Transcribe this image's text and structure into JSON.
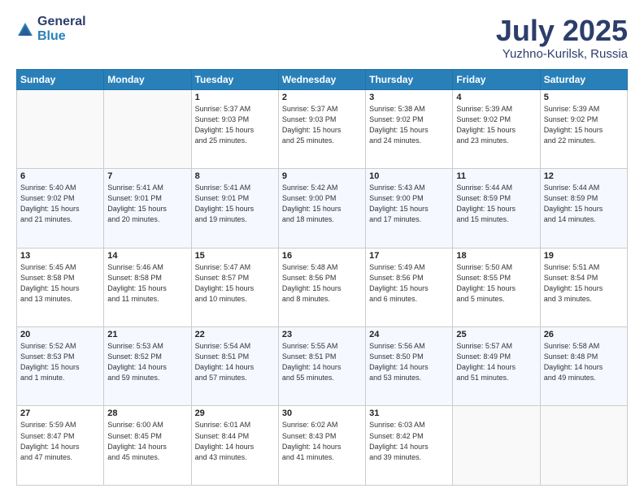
{
  "logo": {
    "general": "General",
    "blue": "Blue"
  },
  "title": {
    "month": "July 2025",
    "location": "Yuzhno-Kurilsk, Russia"
  },
  "weekdays": [
    "Sunday",
    "Monday",
    "Tuesday",
    "Wednesday",
    "Thursday",
    "Friday",
    "Saturday"
  ],
  "weeks": [
    [
      {
        "day": "",
        "info": ""
      },
      {
        "day": "",
        "info": ""
      },
      {
        "day": "1",
        "info": "Sunrise: 5:37 AM\nSunset: 9:03 PM\nDaylight: 15 hours\nand 25 minutes."
      },
      {
        "day": "2",
        "info": "Sunrise: 5:37 AM\nSunset: 9:03 PM\nDaylight: 15 hours\nand 25 minutes."
      },
      {
        "day": "3",
        "info": "Sunrise: 5:38 AM\nSunset: 9:02 PM\nDaylight: 15 hours\nand 24 minutes."
      },
      {
        "day": "4",
        "info": "Sunrise: 5:39 AM\nSunset: 9:02 PM\nDaylight: 15 hours\nand 23 minutes."
      },
      {
        "day": "5",
        "info": "Sunrise: 5:39 AM\nSunset: 9:02 PM\nDaylight: 15 hours\nand 22 minutes."
      }
    ],
    [
      {
        "day": "6",
        "info": "Sunrise: 5:40 AM\nSunset: 9:02 PM\nDaylight: 15 hours\nand 21 minutes."
      },
      {
        "day": "7",
        "info": "Sunrise: 5:41 AM\nSunset: 9:01 PM\nDaylight: 15 hours\nand 20 minutes."
      },
      {
        "day": "8",
        "info": "Sunrise: 5:41 AM\nSunset: 9:01 PM\nDaylight: 15 hours\nand 19 minutes."
      },
      {
        "day": "9",
        "info": "Sunrise: 5:42 AM\nSunset: 9:00 PM\nDaylight: 15 hours\nand 18 minutes."
      },
      {
        "day": "10",
        "info": "Sunrise: 5:43 AM\nSunset: 9:00 PM\nDaylight: 15 hours\nand 17 minutes."
      },
      {
        "day": "11",
        "info": "Sunrise: 5:44 AM\nSunset: 8:59 PM\nDaylight: 15 hours\nand 15 minutes."
      },
      {
        "day": "12",
        "info": "Sunrise: 5:44 AM\nSunset: 8:59 PM\nDaylight: 15 hours\nand 14 minutes."
      }
    ],
    [
      {
        "day": "13",
        "info": "Sunrise: 5:45 AM\nSunset: 8:58 PM\nDaylight: 15 hours\nand 13 minutes."
      },
      {
        "day": "14",
        "info": "Sunrise: 5:46 AM\nSunset: 8:58 PM\nDaylight: 15 hours\nand 11 minutes."
      },
      {
        "day": "15",
        "info": "Sunrise: 5:47 AM\nSunset: 8:57 PM\nDaylight: 15 hours\nand 10 minutes."
      },
      {
        "day": "16",
        "info": "Sunrise: 5:48 AM\nSunset: 8:56 PM\nDaylight: 15 hours\nand 8 minutes."
      },
      {
        "day": "17",
        "info": "Sunrise: 5:49 AM\nSunset: 8:56 PM\nDaylight: 15 hours\nand 6 minutes."
      },
      {
        "day": "18",
        "info": "Sunrise: 5:50 AM\nSunset: 8:55 PM\nDaylight: 15 hours\nand 5 minutes."
      },
      {
        "day": "19",
        "info": "Sunrise: 5:51 AM\nSunset: 8:54 PM\nDaylight: 15 hours\nand 3 minutes."
      }
    ],
    [
      {
        "day": "20",
        "info": "Sunrise: 5:52 AM\nSunset: 8:53 PM\nDaylight: 15 hours\nand 1 minute."
      },
      {
        "day": "21",
        "info": "Sunrise: 5:53 AM\nSunset: 8:52 PM\nDaylight: 14 hours\nand 59 minutes."
      },
      {
        "day": "22",
        "info": "Sunrise: 5:54 AM\nSunset: 8:51 PM\nDaylight: 14 hours\nand 57 minutes."
      },
      {
        "day": "23",
        "info": "Sunrise: 5:55 AM\nSunset: 8:51 PM\nDaylight: 14 hours\nand 55 minutes."
      },
      {
        "day": "24",
        "info": "Sunrise: 5:56 AM\nSunset: 8:50 PM\nDaylight: 14 hours\nand 53 minutes."
      },
      {
        "day": "25",
        "info": "Sunrise: 5:57 AM\nSunset: 8:49 PM\nDaylight: 14 hours\nand 51 minutes."
      },
      {
        "day": "26",
        "info": "Sunrise: 5:58 AM\nSunset: 8:48 PM\nDaylight: 14 hours\nand 49 minutes."
      }
    ],
    [
      {
        "day": "27",
        "info": "Sunrise: 5:59 AM\nSunset: 8:47 PM\nDaylight: 14 hours\nand 47 minutes."
      },
      {
        "day": "28",
        "info": "Sunrise: 6:00 AM\nSunset: 8:45 PM\nDaylight: 14 hours\nand 45 minutes."
      },
      {
        "day": "29",
        "info": "Sunrise: 6:01 AM\nSunset: 8:44 PM\nDaylight: 14 hours\nand 43 minutes."
      },
      {
        "day": "30",
        "info": "Sunrise: 6:02 AM\nSunset: 8:43 PM\nDaylight: 14 hours\nand 41 minutes."
      },
      {
        "day": "31",
        "info": "Sunrise: 6:03 AM\nSunset: 8:42 PM\nDaylight: 14 hours\nand 39 minutes."
      },
      {
        "day": "",
        "info": ""
      },
      {
        "day": "",
        "info": ""
      }
    ]
  ]
}
